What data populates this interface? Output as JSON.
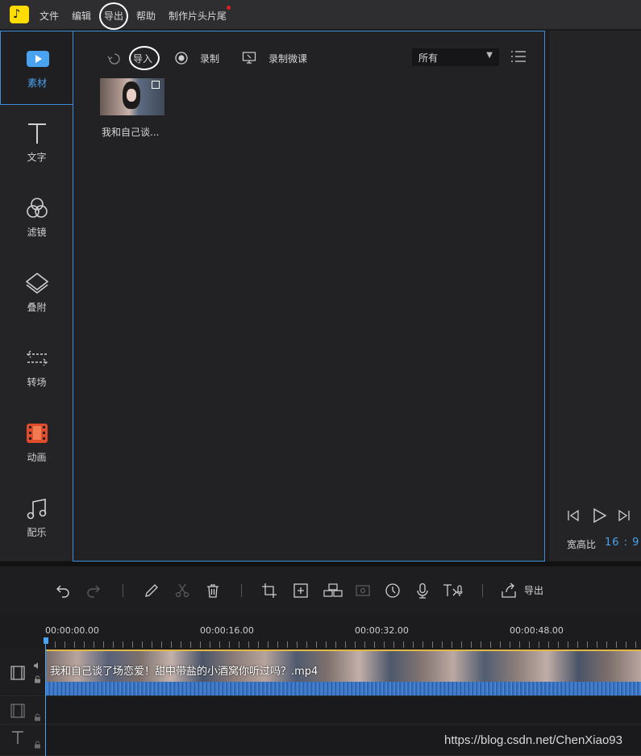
{
  "menu": {
    "items": [
      "文件",
      "编辑",
      "导出",
      "帮助",
      "制作片头片尾"
    ]
  },
  "sidebar": {
    "items": [
      {
        "label": "素材",
        "icon": "media-icon",
        "active": true
      },
      {
        "label": "文字",
        "icon": "text-icon"
      },
      {
        "label": "滤镜",
        "icon": "filter-icon"
      },
      {
        "label": "叠附",
        "icon": "overlay-icon"
      },
      {
        "label": "转场",
        "icon": "transition-icon"
      },
      {
        "label": "动画",
        "icon": "animation-icon"
      },
      {
        "label": "配乐",
        "icon": "music-icon"
      }
    ]
  },
  "media": {
    "toolbar": {
      "import_label": "导入",
      "record_label": "录制",
      "record_lesson_label": "录制微课",
      "filter_value": "所有"
    },
    "items": [
      {
        "caption": "我和自己谈..."
      }
    ]
  },
  "preview": {
    "aspect_label": "宽高比",
    "aspect_value": "16 : 9"
  },
  "timeline": {
    "export_label": "导出",
    "ruler": [
      "00:00:00.00",
      "00:00:16.00",
      "00:00:32.00",
      "00:00:48.00"
    ],
    "clip_name": "我和自己谈了场恋爱！甜中带盐的小酒窝你听过吗？.mp4"
  },
  "watermark": "https://blog.csdn.net/ChenXiao93",
  "colors": {
    "accent": "#4aa3f0",
    "logo": "#ffdd00",
    "notification_dot": "#e02020",
    "clip_border": "#e0b84a",
    "waveform": "#3d78c8"
  }
}
